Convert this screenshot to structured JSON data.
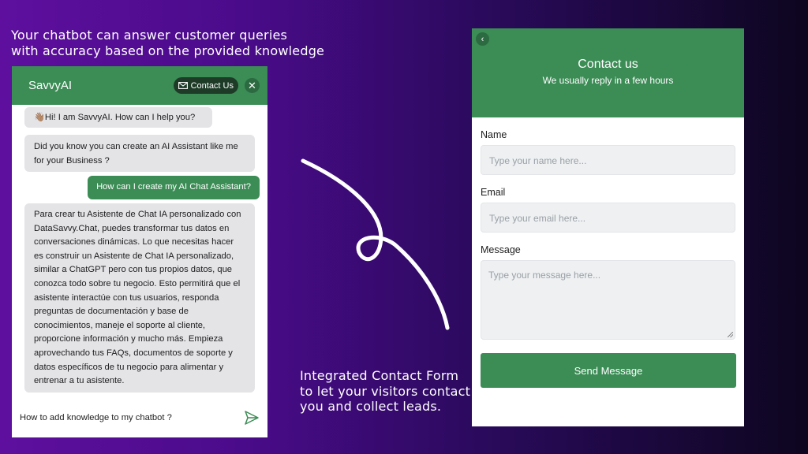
{
  "captions": {
    "top": [
      "Your chatbot can answer customer queries",
      "with accuracy based on the provided knowledge"
    ],
    "bottom": [
      "Integrated Contact Form",
      "to let your visitors contact",
      "you and collect leads."
    ]
  },
  "chat": {
    "title": "SavvyAI",
    "contact_label": "Contact Us",
    "messages": [
      {
        "role": "bot",
        "text": "👋🏽Hi! I am SavvyAI. How can I help you?"
      },
      {
        "role": "bot",
        "text": "Did you know you can create an AI Assistant like me for your Business ?"
      },
      {
        "role": "user",
        "text": "How can I create my AI Chat Assistant?"
      },
      {
        "role": "bot",
        "text": "Para crear tu Asistente de Chat IA personalizado con DataSavvy.Chat, puedes transformar tus datos en conversaciones dinámicas. Lo que necesitas hacer es construir un Asistente de Chat IA personalizado, similar a ChatGPT pero con tus propios datos, que conozca todo sobre tu negocio. Esto permitirá que el asistente interactúe con tus usuarios, responda preguntas de documentación y base de conocimientos, maneje el soporte al cliente, proporcione información y mucho más. Empieza aprovechando tus FAQs, documentos de soporte y datos específicos de tu negocio para alimentar y entrenar a tu asistente."
      }
    ],
    "input_value": "How to add knowledge to my chatbot ?",
    "icons": {
      "contact": "mail-icon",
      "close": "close-icon",
      "send": "send-icon"
    }
  },
  "form": {
    "title": "Contact us",
    "subtitle": "We usually reply in a few hours",
    "fields": [
      {
        "label": "Name",
        "placeholder": "Type your name here..."
      },
      {
        "label": "Email",
        "placeholder": "Type your email here..."
      },
      {
        "label": "Message",
        "placeholder": "Type your message here..."
      }
    ],
    "submit_label": "Send Message",
    "icons": {
      "back": "back-arrow-icon"
    }
  },
  "colors": {
    "accent": "#3b8c55",
    "dark_accent": "#1d3b27",
    "bubble": "#e4e4e7"
  }
}
